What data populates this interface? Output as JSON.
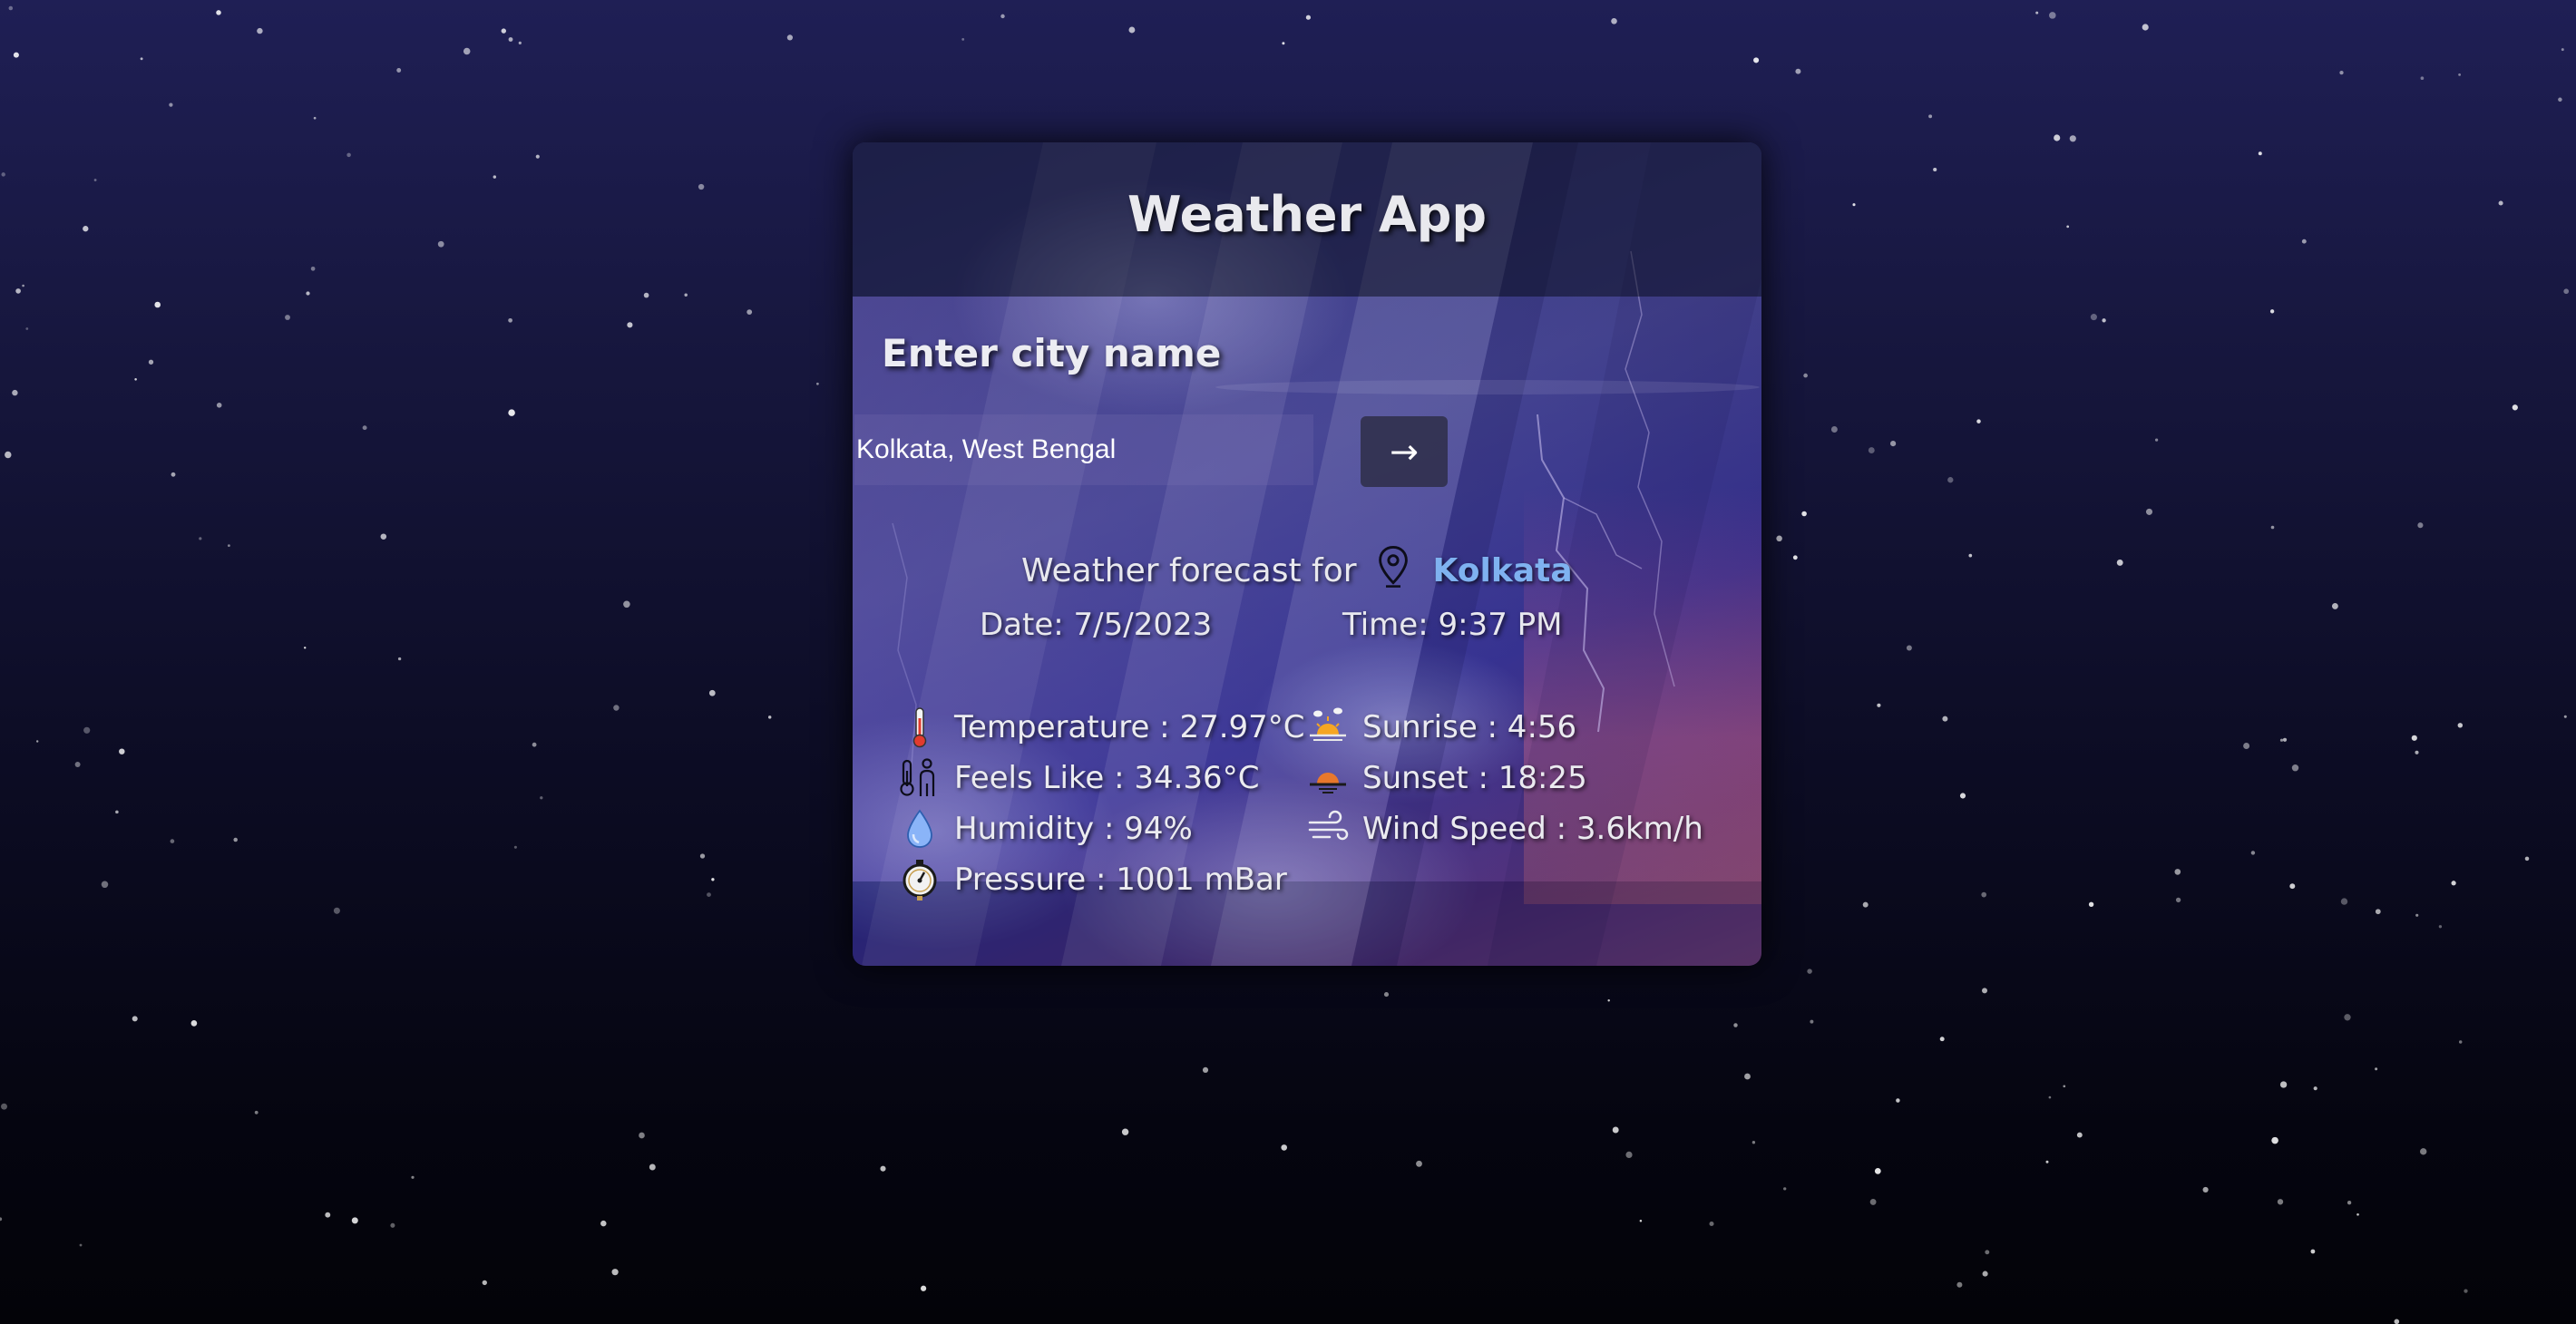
{
  "app": {
    "title": "Weather App"
  },
  "search": {
    "label": "Enter city name",
    "value": "Kolkata, West Bengal",
    "submit_label": "→"
  },
  "forecast": {
    "prefix": "Weather forecast for",
    "city": "Kolkata",
    "location_icon": "location-pin-icon",
    "date": "Date: 7/5/2023",
    "time": "Time: 9:37 PM"
  },
  "stats": {
    "temperature": "Temperature : 27.97°C",
    "feels_like": "Feels Like : 34.36°C",
    "humidity": "Humidity : 94%",
    "pressure": "Pressure : 1001 mBar",
    "sunrise": "Sunrise : 4:56",
    "sunset": "Sunset : 18:25",
    "wind_speed": "Wind Speed : 3.6km/h"
  },
  "icons": {
    "temperature": "thermometer-icon",
    "feels_like": "people-thermometer-icon",
    "humidity": "water-drop-icon",
    "pressure": "pressure-gauge-icon",
    "sunrise": "sunrise-icon",
    "sunset": "sunset-icon",
    "wind_speed": "wind-icon"
  },
  "colors": {
    "city_name": "#7fb2f0",
    "title_text": "#e9e9ee",
    "background_top": "#1f1f55",
    "background_bottom": "#030308"
  }
}
